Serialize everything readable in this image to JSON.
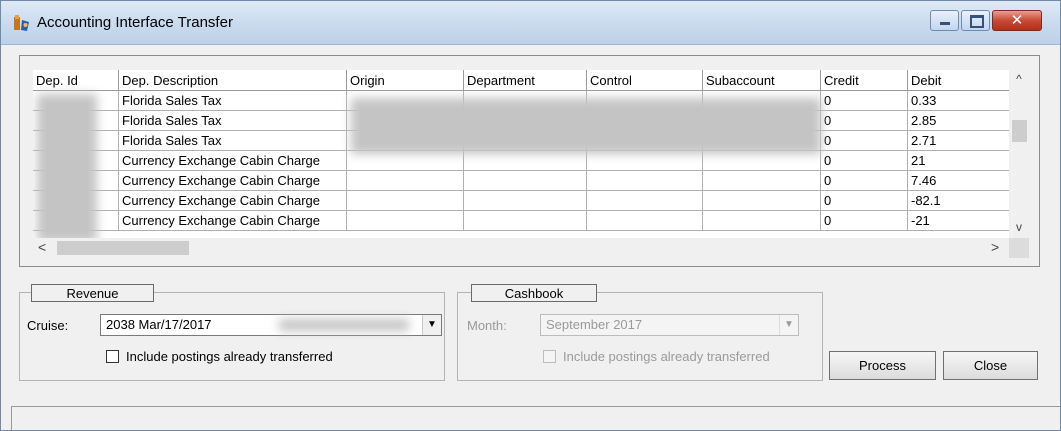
{
  "window": {
    "title": "Accounting Interface Transfer",
    "close_glyph": "✕",
    "icon": "accounting-app-icon"
  },
  "grid": {
    "columns": [
      "Dep. Id",
      "Dep. Description",
      "Origin",
      "Department",
      "Control",
      "Subaccount",
      "Credit",
      "Debit"
    ],
    "rows": [
      {
        "description": "Florida Sales Tax",
        "credit": "0",
        "debit": "0.33"
      },
      {
        "description": "Florida Sales Tax",
        "credit": "0",
        "debit": "2.85"
      },
      {
        "description": "Florida Sales Tax",
        "credit": "0",
        "debit": "2.71"
      },
      {
        "description": "Currency Exchange Cabin Charge",
        "credit": "0",
        "debit": "21"
      },
      {
        "description": "Currency Exchange Cabin Charge",
        "credit": "0",
        "debit": "7.46"
      },
      {
        "description": "Currency Exchange Cabin Charge",
        "credit": "0",
        "debit": "-82.1"
      },
      {
        "description": "Currency Exchange Cabin Charge",
        "credit": "0",
        "debit": "-21"
      }
    ],
    "scroll_up": "^",
    "scroll_down": "v",
    "scroll_left": "<",
    "scroll_right": ">"
  },
  "revenue": {
    "legend": "Revenue",
    "cruise_label": "Cruise:",
    "cruise_value": "2038    Mar/17/2017",
    "include_label": "Include postings already transferred",
    "include_checked": false
  },
  "cashbook": {
    "legend": "Cashbook",
    "month_label": "Month:",
    "month_value": "September 2017",
    "include_label": "Include postings already transferred",
    "include_checked": false
  },
  "buttons": {
    "process": "Process",
    "close": "Close"
  },
  "status": {
    "text": ""
  }
}
